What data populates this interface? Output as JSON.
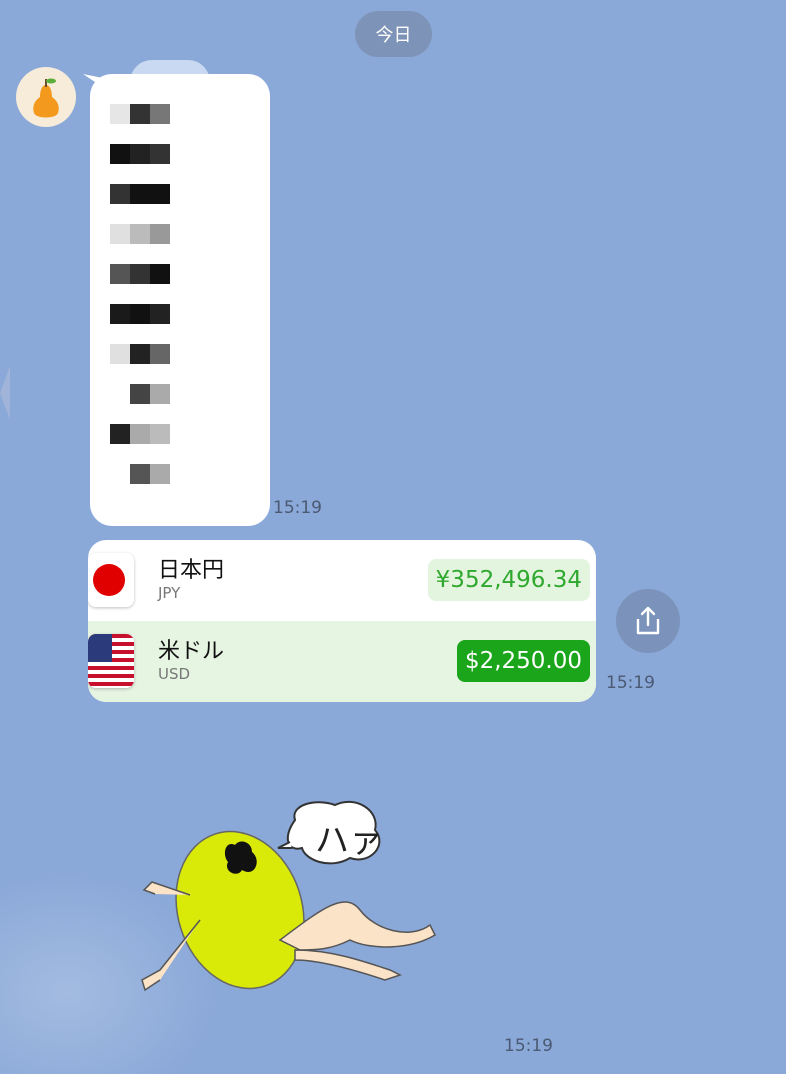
{
  "chat": {
    "date_label": "今日",
    "messages": [
      {
        "time": "15:19"
      },
      {
        "time": "15:19"
      },
      {
        "time": "15:19"
      }
    ]
  },
  "converter": {
    "rows": [
      {
        "name": "日本円",
        "code": "JPY",
        "amount": "¥352,496.34",
        "flag_icon": "japan-flag-icon"
      },
      {
        "name": "米ドル",
        "code": "USD",
        "amount": "$2,250.00",
        "flag_icon": "us-flag-icon",
        "selected": true
      }
    ],
    "share_icon": "share-icon"
  },
  "sticker": {
    "speech_text": "ハァ"
  },
  "colors": {
    "background": "#8aa8d8",
    "accent_green": "#1aa51a",
    "date_pill": "#7d93b7"
  }
}
